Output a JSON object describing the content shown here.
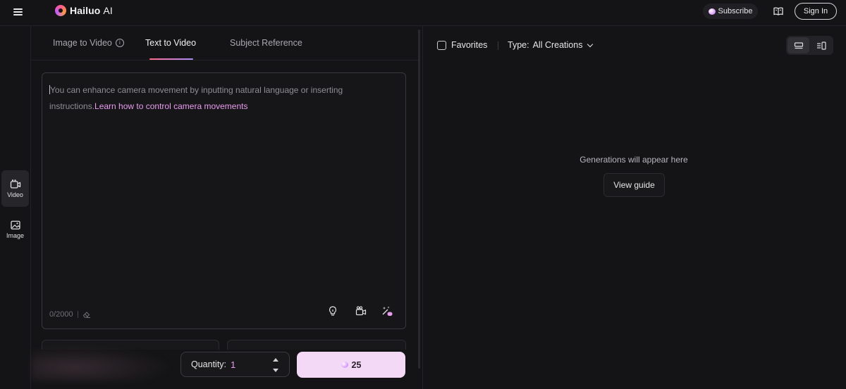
{
  "header": {
    "brand_name": "Hailuo",
    "brand_suffix": "AI",
    "subscribe_label": "Subscribe",
    "signin_label": "Sign In",
    "icons": [
      "menu-icon",
      "hailuo-logo-icon",
      "gem-icon",
      "book-icon"
    ]
  },
  "rail": {
    "items": [
      {
        "label": "Video",
        "icon": "video-icon",
        "active": true
      },
      {
        "label": "Image",
        "icon": "image-icon",
        "active": false
      }
    ]
  },
  "tabs": [
    {
      "label": "Image to Video",
      "active": false,
      "has_info_icon": true
    },
    {
      "label": "Text to Video",
      "active": true
    },
    {
      "label": "Subject Reference",
      "active": false
    }
  ],
  "prompt": {
    "placeholder": "You can enhance camera movement by inputting natural language or inserting instructions.",
    "link_text": "Learn how to control camera movements",
    "counter": "0/2000",
    "tool_icons": [
      "lightbulb-icon",
      "camera-movement-icon",
      "prompt-enhance-icon"
    ]
  },
  "quantity": {
    "label": "Quantity:",
    "value": "1"
  },
  "generate": {
    "credits": "25",
    "icon": "gem-icon"
  },
  "results": {
    "favorites_label": "Favorites",
    "type_label": "Type:",
    "type_value": "All Creations",
    "empty_text": "Generations will appear here",
    "guide_label": "View guide",
    "view_modes": [
      "list-view-icon",
      "side-panel-view-icon"
    ]
  },
  "colors": {
    "background": "#141416",
    "accent_pink": "#e89cf0",
    "generate_button": "#f3d9f6"
  }
}
